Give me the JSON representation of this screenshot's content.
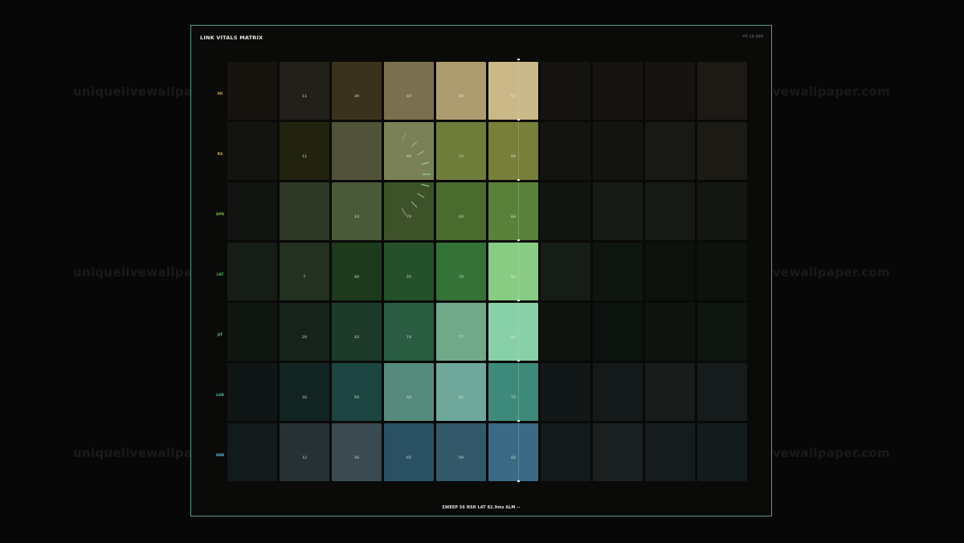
{
  "panel": {
    "title": "LINK VITALS MATRIX",
    "code": "HT-18 999",
    "status": "SWEEP 56  NSR  LAT 82.9ms  ALM --"
  },
  "rows": [
    {
      "label": "PK",
      "color": "#c8a94a",
      "cells": [
        {
          "color": "#17140f",
          "value": ""
        },
        {
          "color": "#22201a",
          "value": "11"
        },
        {
          "color": "#3a321c",
          "value": "39"
        },
        {
          "color": "#7a7050",
          "value": "40"
        },
        {
          "color": "#ac9c70",
          "value": "59"
        },
        {
          "color": "#cbb888",
          "value": "97"
        },
        {
          "color": "#141311",
          "value": ""
        },
        {
          "color": "#171310",
          "value": ""
        },
        {
          "color": "#151410",
          "value": ""
        },
        {
          "color": "#1d1a16",
          "value": ""
        }
      ]
    },
    {
      "label": "RS",
      "color": "#c8b84a",
      "cells": [
        {
          "color": "#13140f",
          "value": ""
        },
        {
          "color": "#22230f",
          "value": "11"
        },
        {
          "color": "#50533a",
          "value": ""
        },
        {
          "color": "#7a8156",
          "value": "40"
        },
        {
          "color": "#6e7d39",
          "value": "73"
        },
        {
          "color": "#777f39",
          "value": "89"
        },
        {
          "color": "#131410",
          "value": ""
        },
        {
          "color": "#141510",
          "value": ""
        },
        {
          "color": "#181914",
          "value": ""
        },
        {
          "color": "#1b1a14",
          "value": ""
        }
      ]
    },
    {
      "label": "SPD",
      "color": "#8dbb4a",
      "cells": [
        {
          "color": "#111410",
          "value": ""
        },
        {
          "color": "#2f3726",
          "value": ""
        },
        {
          "color": "#485a38",
          "value": "14"
        },
        {
          "color": "#3d5229",
          "value": "70"
        },
        {
          "color": "#4a6b2e",
          "value": "43"
        },
        {
          "color": "#5a813a",
          "value": "66"
        },
        {
          "color": "#111511",
          "value": ""
        },
        {
          "color": "#171b16",
          "value": ""
        },
        {
          "color": "#171915",
          "value": ""
        },
        {
          "color": "#141613",
          "value": ""
        }
      ]
    },
    {
      "label": "LAT",
      "color": "#4dbb5a",
      "cells": [
        {
          "color": "#161d16",
          "value": ""
        },
        {
          "color": "#223120",
          "value": "7"
        },
        {
          "color": "#1d3a1c",
          "value": "40"
        },
        {
          "color": "#24502a",
          "value": "55"
        },
        {
          "color": "#347238",
          "value": "78"
        },
        {
          "color": "#88cc84",
          "value": "98"
        },
        {
          "color": "#161c16",
          "value": ""
        },
        {
          "color": "#0f150f",
          "value": ""
        },
        {
          "color": "#0c110c",
          "value": ""
        },
        {
          "color": "#0d120d",
          "value": ""
        }
      ]
    },
    {
      "label": "JIT",
      "color": "#5ac88a",
      "cells": [
        {
          "color": "#101610",
          "value": ""
        },
        {
          "color": "#16231a",
          "value": "20"
        },
        {
          "color": "#1d3a2b",
          "value": "43"
        },
        {
          "color": "#2a5c42",
          "value": "74"
        },
        {
          "color": "#70a88a",
          "value": "77"
        },
        {
          "color": "#88d0a8",
          "value": "94"
        },
        {
          "color": "#0f140f",
          "value": ""
        },
        {
          "color": "#0d130e",
          "value": ""
        },
        {
          "color": "#0f140f",
          "value": ""
        },
        {
          "color": "#101610",
          "value": ""
        }
      ]
    },
    {
      "label": "LOS",
      "color": "#5ac8b0",
      "cells": [
        {
          "color": "#101615",
          "value": ""
        },
        {
          "color": "#122421",
          "value": "26"
        },
        {
          "color": "#1c4440",
          "value": "50"
        },
        {
          "color": "#568a7c",
          "value": "53"
        },
        {
          "color": "#6fa89a",
          "value": "81"
        },
        {
          "color": "#3e8a7a",
          "value": "75"
        },
        {
          "color": "#121717",
          "value": ""
        },
        {
          "color": "#141a19",
          "value": ""
        },
        {
          "color": "#181d1c",
          "value": ""
        },
        {
          "color": "#151c1b",
          "value": ""
        }
      ]
    },
    {
      "label": "SNR",
      "color": "#5ab8d0",
      "cells": [
        {
          "color": "#121a1c",
          "value": ""
        },
        {
          "color": "#263135",
          "value": "12"
        },
        {
          "color": "#3a4a50",
          "value": "36"
        },
        {
          "color": "#2a5064",
          "value": "65"
        },
        {
          "color": "#32586a",
          "value": "59"
        },
        {
          "color": "#3a6a86",
          "value": "42"
        },
        {
          "color": "#121a1c",
          "value": ""
        },
        {
          "color": "#1a1f20",
          "value": ""
        },
        {
          "color": "#161c1d",
          "value": ""
        },
        {
          "color": "#141b1d",
          "value": ""
        }
      ]
    }
  ],
  "watermark": "uniquelivewallpaper.com"
}
